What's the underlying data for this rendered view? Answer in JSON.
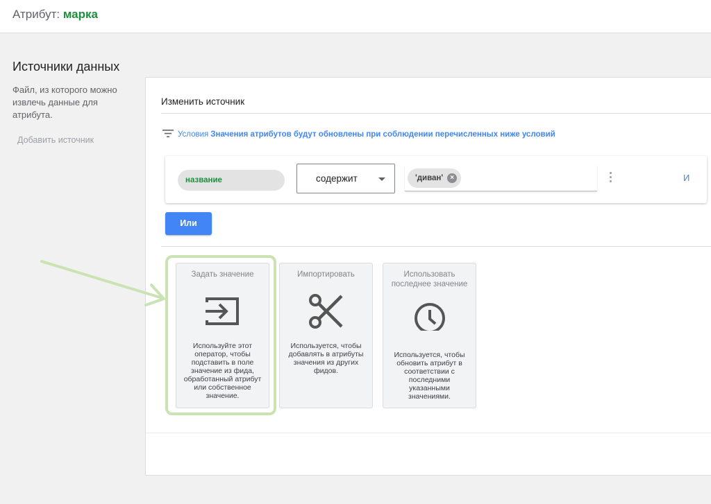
{
  "header": {
    "title_prefix": "Атрибут: ",
    "attribute_name": "марка"
  },
  "sidebar": {
    "heading": "Источники данных",
    "description": "Файл, из которого можно извлечь данные для атрибута.",
    "add_source": "Добавить источник"
  },
  "panel": {
    "title": "Изменить источник",
    "conditions_label": "Условия",
    "conditions_text": "Значения атрибутов будут обновлены при соблюдении перечисленных ниже условий",
    "rule": {
      "attribute": "название",
      "operator": "содержит",
      "value_chip": "'диван'",
      "and_link": "И"
    },
    "or_button": "Или"
  },
  "operators": [
    {
      "title": "Задать значение",
      "icon": "input-arrow-icon",
      "description": "Используйте этот оператор, чтобы подставить в поле значение из фида, обработанный атрибут или собственное значение."
    },
    {
      "title": "Импортировать",
      "icon": "scissors-icon",
      "description": "Используется, чтобы добавлять в атрибуты значения из других фидов."
    },
    {
      "title": "Использовать последнее значение",
      "icon": "clock-icon",
      "description": "Используется, чтобы обновить атрибут в соответствии с последними указанными значениями."
    }
  ],
  "colors": {
    "accent_blue": "#4285f4",
    "accent_green": "#1e8e3e",
    "highlight_green": "#cbe3b3"
  }
}
